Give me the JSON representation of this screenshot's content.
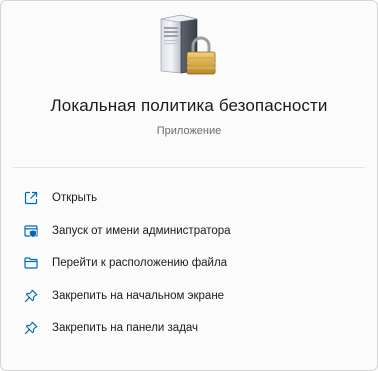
{
  "app": {
    "title": "Локальная политика безопасности",
    "subtitle": "Приложение",
    "icon": "server-lock-icon"
  },
  "menu": {
    "items": [
      {
        "label": "Открыть",
        "icon": "open-external-icon"
      },
      {
        "label": "Запуск от имени администратора",
        "icon": "run-as-admin-icon"
      },
      {
        "label": "Перейти к расположению файла",
        "icon": "folder-icon"
      },
      {
        "label": "Закрепить на начальном экране",
        "icon": "pin-icon"
      },
      {
        "label": "Закрепить на панели задач",
        "icon": "pin-icon"
      }
    ]
  },
  "colors": {
    "accent": "#0067c0",
    "text": "#1b1b1b",
    "secondary_text": "#6b6b6b"
  }
}
